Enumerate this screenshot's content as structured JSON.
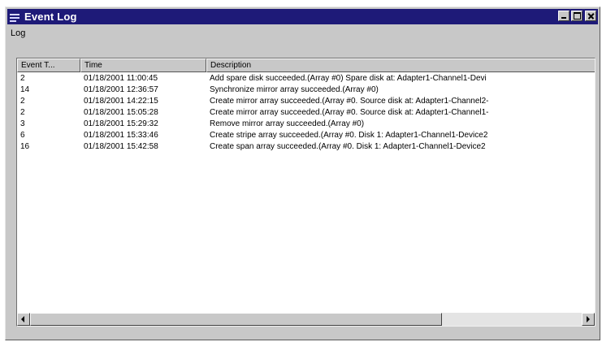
{
  "window": {
    "title": "Event Log"
  },
  "menu": {
    "items": [
      "Log"
    ]
  },
  "listview": {
    "columns": [
      "Event T...",
      "Time",
      "Description"
    ],
    "rows": [
      {
        "event_type": "2",
        "time": "01/18/2001 11:00:45",
        "description": "Add spare disk succeeded.(Array #0) Spare disk at: Adapter1-Channel1-Devi"
      },
      {
        "event_type": "14",
        "time": "01/18/2001 12:36:57",
        "description": "Synchronize mirror array succeeded.(Array #0)"
      },
      {
        "event_type": "2",
        "time": "01/18/2001 14:22:15",
        "description": "Create mirror array succeeded.(Array #0. Source disk at: Adapter1-Channel2-"
      },
      {
        "event_type": "2",
        "time": "01/18/2001 15:05:28",
        "description": "Create mirror array succeeded.(Array #0. Source disk at: Adapter1-Channel1-"
      },
      {
        "event_type": "3",
        "time": "01/18/2001 15:29:32",
        "description": "Remove mirror array succeeded.(Array #0)"
      },
      {
        "event_type": "6",
        "time": "01/18/2001 15:33:46",
        "description": "Create stripe array succeeded.(Array #0. Disk 1: Adapter1-Channel1-Device2"
      },
      {
        "event_type": "16",
        "time": "01/18/2001 15:42:58",
        "description": "Create span array succeeded.(Array #0. Disk 1: Adapter1-Channel1-Device2"
      }
    ]
  },
  "colors": {
    "titlebar": "#1e1a78",
    "face": "#c8c8c8"
  }
}
